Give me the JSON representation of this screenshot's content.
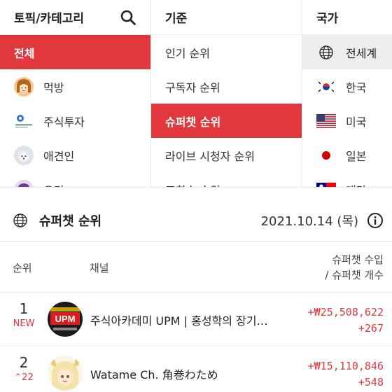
{
  "filters": {
    "category": {
      "header": "토픽/카테고리",
      "items": [
        {
          "label": "전체",
          "selected": true,
          "icon": ""
        },
        {
          "label": "먹방",
          "selected": false,
          "icon": "mukbang-avatar"
        },
        {
          "label": "주식투자",
          "selected": false,
          "icon": "stock-logo"
        },
        {
          "label": "애견인",
          "selected": false,
          "icon": "dog-avatar"
        },
        {
          "label": "요리",
          "selected": false,
          "icon": "cooking-avatar"
        }
      ]
    },
    "criteria": {
      "header": "기준",
      "items": [
        {
          "label": "인기 순위",
          "selected": false
        },
        {
          "label": "구독자 순위",
          "selected": false
        },
        {
          "label": "슈퍼챗 순위",
          "selected": true
        },
        {
          "label": "라이브 시청자 순위",
          "selected": false
        },
        {
          "label": "조회수 순위",
          "selected": false
        }
      ]
    },
    "country": {
      "header": "국가",
      "items": [
        {
          "label": "전세계",
          "selected": true,
          "icon": "globe-icon"
        },
        {
          "label": "한국",
          "selected": false,
          "icon": "korea-flag-icon"
        },
        {
          "label": "미국",
          "selected": false,
          "icon": "usa-flag-icon"
        },
        {
          "label": "일본",
          "selected": false,
          "icon": "japan-flag-icon"
        },
        {
          "label": "대만",
          "selected": false,
          "icon": "taiwan-flag-icon"
        }
      ]
    }
  },
  "ranking": {
    "title": "슈퍼챗 순위",
    "date": "2021.10.14 (목)",
    "columns": {
      "rank": "순위",
      "channel": "채널",
      "metric_line1": "슈퍼챗 수입",
      "metric_line2": "/ 슈퍼챗 개수"
    },
    "rows": [
      {
        "rank": "1",
        "change": "NEW",
        "channel": "주식아카데미 UPM | 홍성학의 장기투자",
        "amount": "+₩25,508,622",
        "count": "+267",
        "avatar_text": "UPM"
      },
      {
        "rank": "2",
        "change": "⌃22",
        "channel": "Watame Ch. 角巻わため",
        "amount": "+₩15,110,846",
        "count": "+548",
        "avatar_text": ""
      }
    ]
  },
  "colors": {
    "accent": "#e0383c",
    "selected_country_bg": "#eeeeee"
  }
}
